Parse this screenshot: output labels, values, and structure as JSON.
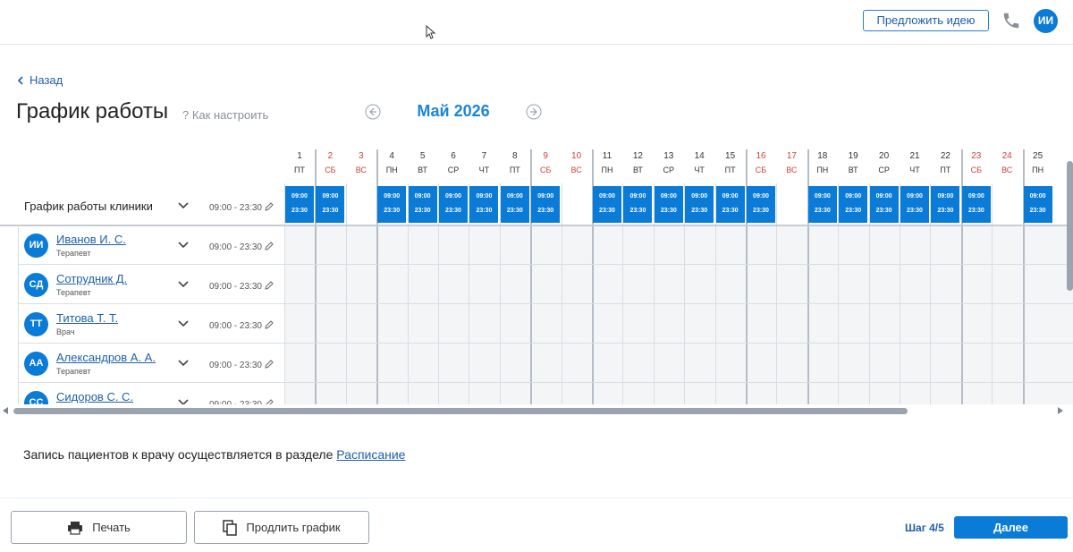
{
  "header": {
    "suggest_label": "Предложить идею",
    "user_initials": "ИИ"
  },
  "nav": {
    "back_label": "Назад"
  },
  "page": {
    "title": "График работы",
    "help_label": "? Как настроить",
    "month_label": "Май 2026"
  },
  "schedule": {
    "days": [
      {
        "num": "1",
        "dow": "ПТ",
        "weekend": false
      },
      {
        "num": "2",
        "dow": "СБ",
        "weekend": true
      },
      {
        "num": "3",
        "dow": "ВС",
        "weekend": true
      },
      {
        "num": "4",
        "dow": "ПН",
        "weekend": false
      },
      {
        "num": "5",
        "dow": "ВТ",
        "weekend": false
      },
      {
        "num": "6",
        "dow": "СР",
        "weekend": false
      },
      {
        "num": "7",
        "dow": "ЧТ",
        "weekend": false
      },
      {
        "num": "8",
        "dow": "ПТ",
        "weekend": false
      },
      {
        "num": "9",
        "dow": "СБ",
        "weekend": true
      },
      {
        "num": "10",
        "dow": "ВС",
        "weekend": true
      },
      {
        "num": "11",
        "dow": "ПН",
        "weekend": false
      },
      {
        "num": "12",
        "dow": "ВТ",
        "weekend": false
      },
      {
        "num": "13",
        "dow": "СР",
        "weekend": false
      },
      {
        "num": "14",
        "dow": "ЧТ",
        "weekend": false
      },
      {
        "num": "15",
        "dow": "ПТ",
        "weekend": false
      },
      {
        "num": "16",
        "dow": "СБ",
        "weekend": true
      },
      {
        "num": "17",
        "dow": "ВС",
        "weekend": true
      },
      {
        "num": "18",
        "dow": "ПН",
        "weekend": false
      },
      {
        "num": "19",
        "dow": "ВТ",
        "weekend": false
      },
      {
        "num": "20",
        "dow": "СР",
        "weekend": false
      },
      {
        "num": "21",
        "dow": "ЧТ",
        "weekend": false
      },
      {
        "num": "22",
        "dow": "ПТ",
        "weekend": false
      },
      {
        "num": "23",
        "dow": "СБ",
        "weekend": true
      },
      {
        "num": "24",
        "dow": "ВС",
        "weekend": true
      },
      {
        "num": "25",
        "dow": "ПН",
        "weekend": false
      }
    ],
    "clinic": {
      "label": "График работы клиники",
      "hours": "09:00 - 23:30",
      "shift_start": "09:00",
      "shift_end": "23:30",
      "working_days": [
        1,
        2,
        4,
        5,
        6,
        7,
        8,
        9,
        11,
        12,
        13,
        14,
        15,
        16,
        18,
        19,
        20,
        21,
        22,
        23,
        25
      ]
    },
    "employees": [
      {
        "initials": "ИИ",
        "name": "Иванов И. С.",
        "role": "Терапевт",
        "hours": "09:00 - 23:30"
      },
      {
        "initials": "СД",
        "name": "Сотрудник Д.",
        "role": "Терапевт",
        "hours": "09:00 - 23:30"
      },
      {
        "initials": "ТТ",
        "name": "Титова Т. Т.",
        "role": "Врач",
        "hours": "09:00 - 23:30"
      },
      {
        "initials": "АА",
        "name": "Александров А. А.",
        "role": "Терапевт",
        "hours": "09:00 - 23:30"
      },
      {
        "initials": "СС",
        "name": "Сидоров С. С.",
        "role": "",
        "hours": "09:00 - 23:30"
      }
    ]
  },
  "note": {
    "text": "Запись пациентов к врачу осуществляется в разделе ",
    "link": "Расписание"
  },
  "footer": {
    "print_label": "Печать",
    "extend_label": "Продлить график",
    "step_label": "Шаг 4/5",
    "next_label": "Далее"
  },
  "colors": {
    "accent": "#0a7bd6",
    "weekend": "#d0413a",
    "link": "#1f5fa8"
  }
}
